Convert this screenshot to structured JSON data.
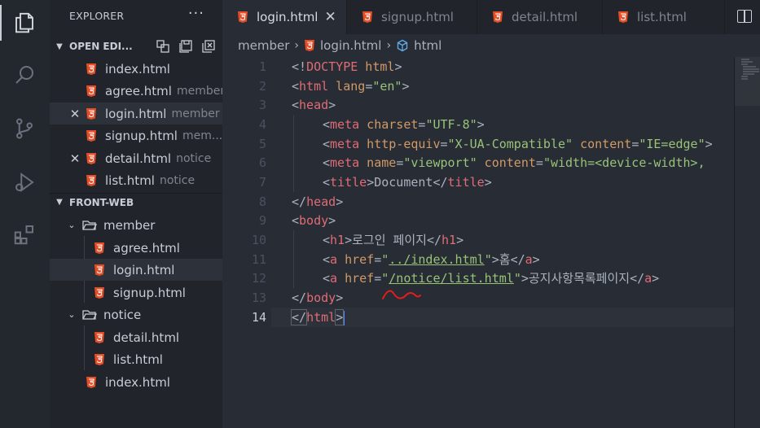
{
  "sidebar": {
    "title": "EXPLORER",
    "open_editors": {
      "label": "OPEN EDI...",
      "items": [
        {
          "name": "index.html",
          "desc": ""
        },
        {
          "name": "agree.html",
          "desc": "member"
        },
        {
          "name": "login.html",
          "desc": "member"
        },
        {
          "name": "signup.html",
          "desc": "mem..."
        },
        {
          "name": "detail.html",
          "desc": "notice"
        },
        {
          "name": "list.html",
          "desc": "notice"
        }
      ]
    },
    "workspace": {
      "label": "FRONT-WEB",
      "member_folder": "member",
      "member_files": [
        "agree.html",
        "login.html",
        "signup.html"
      ],
      "notice_folder": "notice",
      "notice_files": [
        "detail.html",
        "list.html"
      ],
      "root_file": "index.html"
    }
  },
  "tabs": [
    "login.html",
    "signup.html",
    "detail.html",
    "list.html"
  ],
  "breadcrumb": {
    "folder": "member",
    "file": "login.html",
    "symbol": "html"
  },
  "editor": {
    "line_numbers": [
      "1",
      "2",
      "3",
      "4",
      "5",
      "6",
      "7",
      "8",
      "9",
      "10",
      "11",
      "12",
      "13",
      "14"
    ],
    "current_line": 14,
    "lines": {
      "l1": {
        "lt": "<!",
        "tag": "DOCTYPE",
        "rest": " html",
        "gt": ">"
      },
      "l2": {
        "lt": "<",
        "tag": "html",
        "attr": " lang",
        "eq": "=",
        "val": "\"en\"",
        "gt": ">"
      },
      "l3": {
        "lt": "<",
        "tag": "head",
        "gt": ">"
      },
      "l4": {
        "lt": "<",
        "tag": "meta",
        "attr": " charset",
        "eq": "=",
        "val": "\"UTF-8\"",
        "gt": ">"
      },
      "l5": {
        "lt": "<",
        "tag": "meta",
        "attr": " http-equiv",
        "eq": "=",
        "val": "\"X-UA-Compatible\"",
        "attr2": " content",
        "eq2": "=",
        "val2": "\"IE=edge\"",
        "gt": ">"
      },
      "l6": {
        "lt": "<",
        "tag": "meta",
        "attr": " name",
        "eq": "=",
        "val": "\"viewport\"",
        "attr2": " content",
        "eq2": "=",
        "val2": "\"width=<device-width>,"
      },
      "l7": {
        "lt": "<",
        "tag": "title",
        "gt": ">",
        "text": "Document",
        "lt2": "</",
        "tag2": "title",
        "gt2": ">"
      },
      "l8": {
        "lt": "</",
        "tag": "head",
        "gt": ">"
      },
      "l9": {
        "lt": "<",
        "tag": "body",
        "gt": ">"
      },
      "l10": {
        "lt": "<",
        "tag": "h1",
        "gt": ">",
        "text": "로그인 페이지",
        "lt2": "</",
        "tag2": "h1",
        "gt2": ">"
      },
      "l11": {
        "lt": "<",
        "tag": "a",
        "attr": " href",
        "eq": "=",
        "q1": "\"",
        "val": "../index.html",
        "q2": "\"",
        "gt": ">",
        "text": "홈",
        "lt2": "</",
        "tag2": "a",
        "gt2": ">"
      },
      "l12": {
        "lt": "<",
        "tag": "a",
        "attr": " href",
        "eq": "=",
        "q1": "\"",
        "val": "/notice/list.html",
        "q2": "\"",
        "gt": ">",
        "text": "공지사항목록페이지",
        "lt2": "</",
        "tag2": "a",
        "gt2": ">"
      },
      "l13": {
        "lt": "</",
        "tag": "body",
        "gt": ">"
      },
      "l14": {
        "lt": "</",
        "tag": "html",
        "gt": ">"
      }
    }
  },
  "colors": {
    "tag": "#e06c75",
    "attribute": "#d19a66",
    "string": "#98c379",
    "annotation": "#e51c1c"
  }
}
